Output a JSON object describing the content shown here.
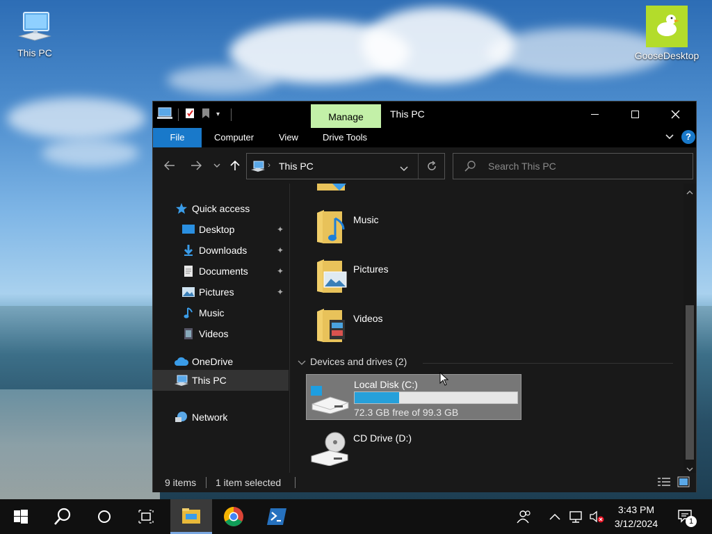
{
  "desktop": {
    "icons": [
      {
        "label": "This PC"
      },
      {
        "label": "GooseDesktop"
      }
    ]
  },
  "window": {
    "title": "This PC",
    "manage_tab": "Manage",
    "ribbon_tabs": [
      "File",
      "Computer",
      "View",
      "Drive Tools"
    ],
    "address": "This PC",
    "search_placeholder": "Search This PC",
    "nav": {
      "quick_access": "Quick access",
      "items": [
        {
          "label": "Desktop",
          "pinned": true
        },
        {
          "label": "Downloads",
          "pinned": true
        },
        {
          "label": "Documents",
          "pinned": true
        },
        {
          "label": "Pictures",
          "pinned": true
        },
        {
          "label": "Music",
          "pinned": false
        },
        {
          "label": "Videos",
          "pinned": false
        }
      ],
      "onedrive": "OneDrive",
      "this_pc": "This PC",
      "network": "Network"
    },
    "folders": [
      {
        "name": "Music"
      },
      {
        "name": "Pictures"
      },
      {
        "name": "Videos"
      }
    ],
    "devices_header": "Devices and drives (2)",
    "drives": [
      {
        "name": "Local Disk (C:)",
        "free_text": "72.3 GB free of 99.3 GB",
        "used_fraction": 0.272,
        "selected": true
      },
      {
        "name": "CD Drive (D:)"
      }
    ],
    "status": {
      "items": "9 items",
      "selected": "1 item selected"
    }
  },
  "taskbar": {
    "clock_time": "3:43 PM",
    "clock_date": "3/12/2024",
    "notification_count": "1"
  },
  "colors": {
    "accent": "#1979ca",
    "manage_tab": "#c3f0a8",
    "drive_bar": "#26a0da"
  }
}
